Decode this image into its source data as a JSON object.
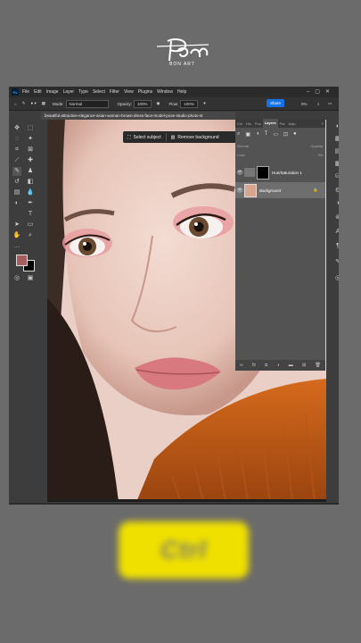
{
  "branding": {
    "signature": "Bon",
    "subtitle": "BON ART"
  },
  "menu": {
    "app_icon": "Ps",
    "items": [
      "File",
      "Edit",
      "Image",
      "Layer",
      "Type",
      "Select",
      "Filter",
      "View",
      "Plugins",
      "Window",
      "Help"
    ]
  },
  "options": {
    "mode_label": "Mode:",
    "mode_value": "Normal",
    "opacity_label": "Opacity:",
    "opacity_value": "100%",
    "flow_label": "Flow:",
    "flow_value": "100%",
    "share_label": "Share",
    "angle_value": "0%"
  },
  "document": {
    "tab_title": "beautiful-attractive-elegance-asian-woman-brown-dress-face-model-pose-studio-photo-st"
  },
  "contextual_bar": {
    "select_subject": "Select subject",
    "remove_background": "Remove background"
  },
  "layers_panel": {
    "tabs": [
      "Clo",
      "His",
      "Pos",
      "Layers",
      "Pat",
      "Adju"
    ],
    "active_tab": "Layers",
    "blend_mode": "Normal",
    "opacity_label": "Opacity:",
    "lock_label": "Lock:",
    "fill_label": "Fill:",
    "layers": [
      {
        "name": "Hue/Saturation 1",
        "selected": false
      },
      {
        "name": "Background",
        "selected": true
      }
    ]
  },
  "overlay_key": {
    "label": "Ctrl"
  },
  "colors": {
    "foreground_swatch": "#a85c5c",
    "background_swatch": "#000000",
    "share_accent": "#1473e6",
    "key_highlight": "#f0e000"
  }
}
